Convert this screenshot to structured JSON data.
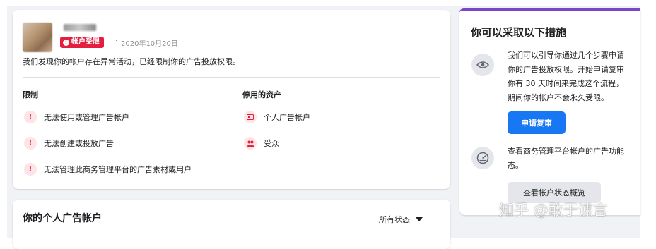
{
  "alert": {
    "status_badge": "帐户受限",
    "separator": "·",
    "date": "2020年10月20日",
    "description": "我们发现你的帐户存在异常活动，已经限制你的广告投放权限。",
    "limits_title": "限制",
    "limits": [
      "无法使用或管理广告帐户",
      "无法创建或投放广告",
      "无法管理此商务管理平台的广告素材或用户"
    ],
    "disabled_title": "停用的资产",
    "disabled_assets": [
      "个人广告帐户",
      "受众"
    ]
  },
  "accounts": {
    "title": "你的个人广告帐户",
    "filter_label": "所有状态"
  },
  "actions": {
    "title": "你可以采取以下措施",
    "appeal_text": [
      "我们可以引导你通过几个步骤申请",
      "你的广告投放权限。开始申请复审",
      "你有 30 天时间来完成这个流程，",
      "期间你的帐户不会永久受限。"
    ],
    "appeal_button": "申请复审",
    "status_text": [
      "查看商务管理平台帐户的广告功能",
      "态。"
    ],
    "status_button": "查看帐户状态概览"
  },
  "watermark": "知乎 @敢于谏言",
  "colors": {
    "accent_red": "#e41e3f",
    "primary_blue": "#1877f2",
    "purple_bar": "#7b45c9",
    "page_bg": "#f0f2f5"
  }
}
